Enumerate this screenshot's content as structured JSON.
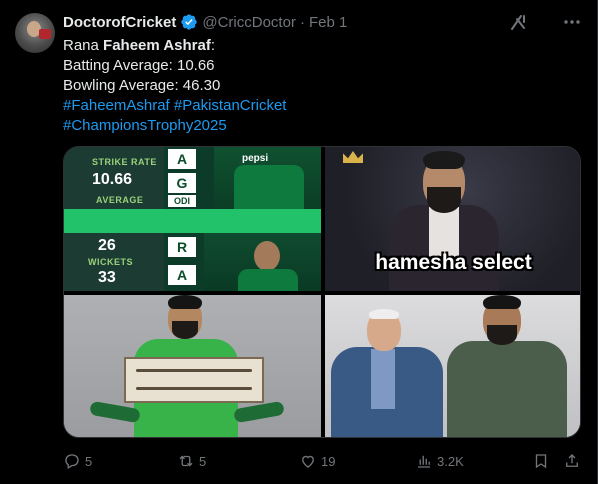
{
  "author": {
    "display_name": "DoctorofCricket",
    "handle": "@CriccDoctor",
    "separator": "·",
    "date": "Feb 1"
  },
  "tweet": {
    "name_prefix": "Rana ",
    "name_bold": "Faheem Ashraf",
    "name_suffix": ":",
    "batting": "Batting Average: 10.66",
    "bowling": "Bowling Average: 46.30",
    "hashtag1": "#FaheemAshraf",
    "hashtag2": "#PakistanCricket",
    "hashtag3": "#ChampionsTrophy2025"
  },
  "media": {
    "stats": {
      "label1": "STRIKE RATE",
      "value1": "10.66",
      "label2": "AVERAGE",
      "value2": "26",
      "label3": "WICKETS",
      "value3": "33",
      "letter1": "A",
      "letter2": "G",
      "odi": "ODI",
      "letter3": "R",
      "letter4": "A",
      "sponsor": "pepsi"
    },
    "caption": "hamesha select"
  },
  "engagement": {
    "replies": "5",
    "reposts": "5",
    "likes": "19",
    "views": "3.2K"
  },
  "colors": {
    "accent": "#1d9bf0",
    "muted": "#71767b",
    "text": "#e7e9ea",
    "background": "#000000"
  },
  "icons": [
    "verified-icon",
    "grok-icon",
    "more-icon",
    "reply-icon",
    "repost-icon",
    "like-icon",
    "views-icon",
    "bookmark-icon",
    "share-icon"
  ]
}
